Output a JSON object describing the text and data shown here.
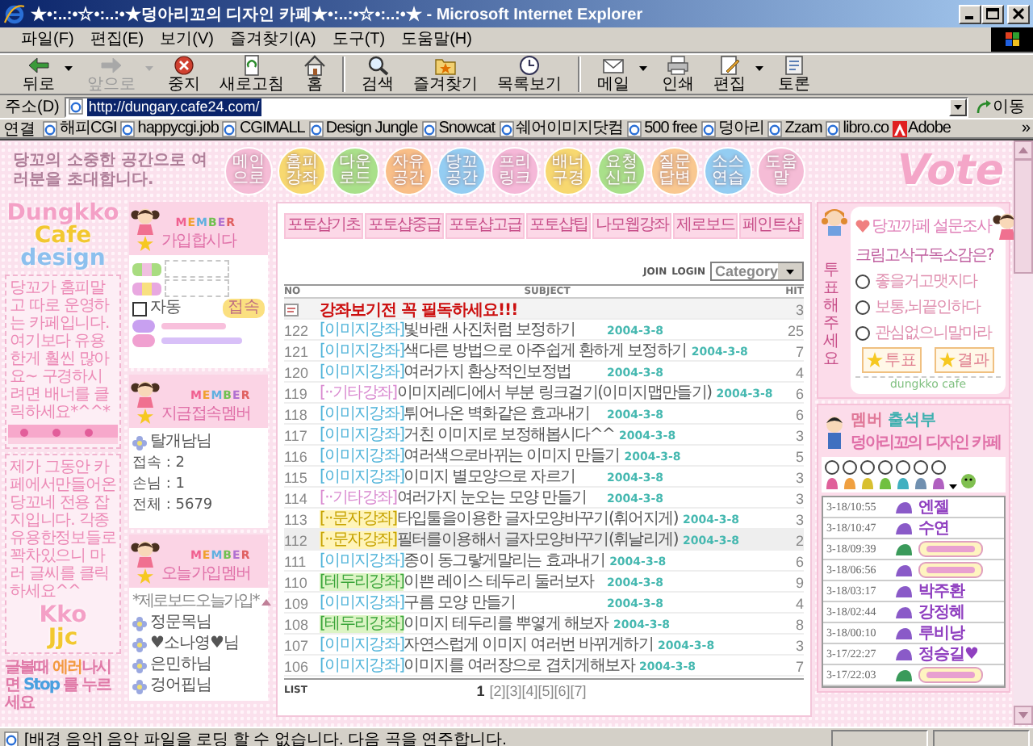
{
  "window": {
    "title": "★•:..:•☆•:..:•★덩아리꼬의 디자인 카페★•:..:•☆•:..:•★ - Microsoft Internet Explorer"
  },
  "menu": [
    "파일(F)",
    "편집(E)",
    "보기(V)",
    "즐겨찾기(A)",
    "도구(T)",
    "도움말(H)"
  ],
  "toolbar": [
    [
      {
        "kind": "back",
        "label": "뒤로",
        "disabled": false,
        "dropdown": true
      },
      {
        "kind": "forward",
        "label": "앞으로",
        "disabled": true,
        "dropdown": true
      },
      {
        "kind": "stop",
        "label": "중지",
        "disabled": false,
        "dropdown": false
      },
      {
        "kind": "refresh",
        "label": "새로고침",
        "disabled": false,
        "dropdown": false
      },
      {
        "kind": "home",
        "label": "홈",
        "disabled": false,
        "dropdown": false
      }
    ],
    [
      {
        "kind": "search",
        "label": "검색",
        "disabled": false,
        "dropdown": false
      },
      {
        "kind": "favorites",
        "label": "즐겨찾기",
        "disabled": false,
        "dropdown": false
      },
      {
        "kind": "history",
        "label": "목록보기",
        "disabled": false,
        "dropdown": false
      }
    ],
    [
      {
        "kind": "mail",
        "label": "메일",
        "disabled": false,
        "dropdown": true
      },
      {
        "kind": "print",
        "label": "인쇄",
        "disabled": false,
        "dropdown": false
      },
      {
        "kind": "edit",
        "label": "편집",
        "disabled": false,
        "dropdown": true
      },
      {
        "kind": "discuss",
        "label": "토론",
        "disabled": false,
        "dropdown": false
      }
    ]
  ],
  "address": {
    "label": "주소(D)",
    "value": "http://dungary.cafe24.com/",
    "value_selected": true,
    "go": "이동"
  },
  "links": {
    "label": "연결",
    "more": "»",
    "items": [
      {
        "label": "해피CGI",
        "kind": "page"
      },
      {
        "label": "happycgi.job",
        "kind": "page"
      },
      {
        "label": "CGIMALL",
        "kind": "page"
      },
      {
        "label": "Design Jungle",
        "kind": "page"
      },
      {
        "label": "Snowcat",
        "kind": "page"
      },
      {
        "label": "쉐어이미지닷컴",
        "kind": "page"
      },
      {
        "label": "500 free",
        "kind": "page"
      },
      {
        "label": "덩아리",
        "kind": "page"
      },
      {
        "label": "Zzam",
        "kind": "page"
      },
      {
        "label": "libro.co",
        "kind": "page"
      },
      {
        "label": "Adobe",
        "kind": "adobe"
      }
    ]
  },
  "page": {
    "welcome": "당꼬의 소중한 공간으로 여러분을 초대합니다.",
    "nav": [
      {
        "label": "메인으로",
        "color": "#f5bcd6"
      },
      {
        "label": "홈피강좌",
        "color": "#f7d870"
      },
      {
        "label": "다운로드",
        "color": "#a9e08a"
      },
      {
        "label": "자유공간",
        "color": "#f9bf88"
      },
      {
        "label": "당꼬공간",
        "color": "#94cdf2"
      },
      {
        "label": "프리링크",
        "color": "#f5b8d8"
      },
      {
        "label": "배너구경",
        "color": "#f7d870"
      },
      {
        "label": "요청신고",
        "color": "#a9e08a"
      },
      {
        "label": "질문답변",
        "color": "#f9c890"
      },
      {
        "label": "소스연습",
        "color": "#94cdf2"
      },
      {
        "label": "도움말",
        "color": "#f5bcd6"
      }
    ],
    "vote_logo": "Vote",
    "left": {
      "logo": [
        "Dungkko",
        "Cafe",
        "design"
      ],
      "intro": "당꼬가 홈피말고 따로 운영하는 카페입니다. 여기보다 유용한게 훨씬 많아요~ 구경하시려면 배너를 클릭하세요*^^*",
      "magazine": "제가 그동안 카페에서만들어온 당꼬네 전용 잡지입니다. 각종 유용한정보들로 꽉차있으니 마러 글씨를 클릭하세요^^",
      "magazine_logo": [
        "Kko",
        "Jjc"
      ],
      "tip": [
        {
          "text": "글볼때 ",
          "kind": "plain"
        },
        {
          "text": "에러",
          "kind": "accent"
        },
        {
          "text": "나시면 ",
          "kind": "plain"
        },
        {
          "text": "Stop",
          "kind": "stop"
        },
        {
          "text": " 를 누르세요",
          "kind": "plain"
        }
      ]
    },
    "members": {
      "login": {
        "tag": "MEMBER",
        "title": "가입합시다",
        "auto_label": "자동",
        "auto_checked": false,
        "submit": "접속"
      },
      "online": {
        "tag": "MEMBER",
        "title": "지금접속멤버",
        "members": [
          "탈개남님"
        ],
        "stats": [
          "접속 : 2",
          "손님 : 1",
          "전체 : 5679"
        ]
      },
      "new_members": {
        "tag": "MEMBER",
        "title": "오늘가입멤버",
        "heading": "*제로보드오늘가입*",
        "members": [
          "정문목님",
          "♥소나영♥님",
          "은민하님",
          "겅어핍님"
        ]
      }
    },
    "board": {
      "tabs": [
        "포토샵기초",
        "포토샵중급",
        "포토샵고급",
        "포토샵팁",
        "나모웹강좌",
        "제로보드",
        "페인트샵"
      ],
      "join": "JOIN",
      "login": "LOGIN",
      "category": "Category",
      "columns": [
        "NO",
        "SUBJECT",
        "HIT"
      ],
      "notice": {
        "title": "강좌보기전 꼭 필독하세요!!!",
        "hit": "3"
      },
      "rows": [
        {
          "no": "122",
          "kind": "image",
          "category": "[이미지강좌]",
          "title": "빛바랜 사진처럼 보정하기",
          "date": "2004-3-8",
          "hit": "25",
          "selected": false
        },
        {
          "no": "121",
          "kind": "image",
          "category": "[이미지강좌]",
          "title": "색다른 방법으로 아주쉽게 환하게 보정하기",
          "date": "2004-3-8",
          "hit": "7",
          "selected": false
        },
        {
          "no": "120",
          "kind": "image",
          "category": "[이미지강좌]",
          "title": "여러가지 환상적인보정법",
          "date": "2004-3-8",
          "hit": "4",
          "selected": false
        },
        {
          "no": "119",
          "kind": "etc",
          "category": "[··기타강좌]",
          "title": "이미지레디에서 부분 링크걸기(이미지맵만들기)",
          "date": "2004-3-8",
          "hit": "6",
          "selected": false
        },
        {
          "no": "118",
          "kind": "image",
          "category": "[이미지강좌]",
          "title": "튀어나온 벽화같은 효과내기",
          "date": "2004-3-8",
          "hit": "6",
          "selected": false
        },
        {
          "no": "117",
          "kind": "image",
          "category": "[이미지강좌]",
          "title": "거친 이미지로 보정해봅시다^^",
          "date": "2004-3-8",
          "hit": "3",
          "selected": false
        },
        {
          "no": "116",
          "kind": "image",
          "category": "[이미지강좌]",
          "title": "여러색으로바뀌는 이미지 만들기",
          "date": "2004-3-8",
          "hit": "5",
          "selected": false
        },
        {
          "no": "115",
          "kind": "image",
          "category": "[이미지강좌]",
          "title": "이미지 별모양으로 자르기",
          "date": "2004-3-8",
          "hit": "3",
          "selected": false
        },
        {
          "no": "114",
          "kind": "etc",
          "category": "[··기타강좌]",
          "title": "여러가지 눈오는 모양 만들기",
          "date": "2004-3-8",
          "hit": "3",
          "selected": false
        },
        {
          "no": "113",
          "kind": "text",
          "category": "[··문자강좌]",
          "title": "타입툴을이용한 글자모양바꾸기(휘어지게)",
          "date": "2004-3-8",
          "hit": "3",
          "selected": false
        },
        {
          "no": "112",
          "kind": "text",
          "category": "[··문자강좌]",
          "title": "필터를이용해서 글자모양바꾸기(휘날리게)",
          "date": "2004-3-8",
          "hit": "2",
          "selected": true
        },
        {
          "no": "111",
          "kind": "image",
          "category": "[이미지강좌]",
          "title": "종이 동그랗게말리는 효과내기",
          "date": "2004-3-8",
          "hit": "6",
          "selected": false
        },
        {
          "no": "110",
          "kind": "border",
          "category": "[테두리강좌]",
          "title": "이쁜 레이스 테두리 둘러보자",
          "date": "2004-3-8",
          "hit": "9",
          "selected": false
        },
        {
          "no": "109",
          "kind": "image",
          "category": "[이미지강좌]",
          "title": "구름 모양 만들기",
          "date": "2004-3-8",
          "hit": "4",
          "selected": false
        },
        {
          "no": "108",
          "kind": "border",
          "category": "[테두리강좌]",
          "title": "이미지 테두리를 뿌옇게 해보자",
          "date": "2004-3-8",
          "hit": "8",
          "selected": false
        },
        {
          "no": "107",
          "kind": "image",
          "category": "[이미지강좌]",
          "title": "자연스럽게 이미지 여러번 바뀌게하기",
          "date": "2004-3-8",
          "hit": "3",
          "selected": false
        },
        {
          "no": "106",
          "kind": "image",
          "category": "[이미지강좌]",
          "title": "이미지를 여러장으로 겹치게해보자",
          "date": "2004-3-8",
          "hit": "7",
          "selected": false
        }
      ],
      "list": "LIST",
      "pages": [
        {
          "label": "1",
          "selected": true
        },
        {
          "label": "[2]",
          "selected": false
        },
        {
          "label": "[3]",
          "selected": false
        },
        {
          "label": "[4]",
          "selected": false
        },
        {
          "label": "[5]",
          "selected": false
        },
        {
          "label": "[6]",
          "selected": false
        },
        {
          "label": "[7]",
          "selected": false
        }
      ]
    },
    "right": {
      "vote": {
        "side": "투표해주세요",
        "title": "당꼬까페 설문조사",
        "question": "크림고삭구독소감은?",
        "options": [
          {
            "label": "좋을거고맷지다",
            "selected": false
          },
          {
            "label": "보통,뇌끝인하다",
            "selected": false
          },
          {
            "label": "관심없으니말마라",
            "selected": false
          }
        ],
        "buttons": [
          "투표",
          "결과"
        ],
        "footer": "dungkko cafe"
      },
      "attendance": {
        "title": [
          "멤버",
          "출석부"
        ],
        "subtitle": "덩아리꼬의 디자인 카페",
        "moods": [
          {
            "color": "#e0609a",
            "selected": false
          },
          {
            "color": "#f0a040",
            "selected": false
          },
          {
            "color": "#d8c030",
            "selected": false
          },
          {
            "color": "#70c040",
            "selected": false
          },
          {
            "color": "#40b0c0",
            "selected": false
          },
          {
            "color": "#7090b0",
            "selected": false
          },
          {
            "color": "#b060c0",
            "selected": false
          }
        ],
        "entries": [
          {
            "time": "3-18/10:55",
            "kind": "text",
            "name": "엔젤",
            "color": "#8a5ac8"
          },
          {
            "time": "3-18/10:47",
            "kind": "text",
            "name": "수연",
            "color": "#8a5ac8"
          },
          {
            "time": "3-18/09:39",
            "kind": "image",
            "color": "#3a9a5a"
          },
          {
            "time": "3-18/06:56",
            "kind": "image",
            "color": "#8a5ac8"
          },
          {
            "time": "3-18/03:17",
            "kind": "text",
            "name": "박주환",
            "color": "#8a5ac8"
          },
          {
            "time": "3-18/02:44",
            "kind": "text",
            "name": "강정혜",
            "color": "#8a5ac8"
          },
          {
            "time": "3-18/00:10",
            "kind": "text",
            "name": "루비낭",
            "color": "#8a5ac8"
          },
          {
            "time": "3-17/22:27",
            "kind": "text",
            "name": "정승길♥",
            "color": "#8a5ac8"
          },
          {
            "time": "3-17/22:03",
            "kind": "image",
            "color": "#3a9a5a"
          }
        ]
      }
    }
  },
  "status_bar": {
    "text": "[배경 음악] 음악 파일을 로딩 할 수 없습니다. 다음 곡을 연주합니다."
  }
}
